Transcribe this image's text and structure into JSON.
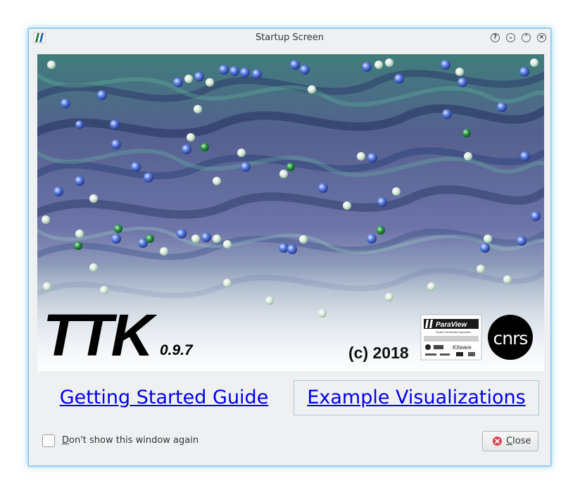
{
  "window": {
    "title": "Startup Screen",
    "buttons": {
      "help": "?",
      "minimize": "⌄",
      "maximize": "⌃",
      "close": "×"
    }
  },
  "banner": {
    "logo_text": "TTK",
    "version": "0.9.7",
    "copyright": "(c) 2018",
    "paraview_logo_text": "ParaView",
    "paraview_subtitle": "Parallel Visualization Application",
    "kitware_text": "Kitware",
    "cnrs_text": "cnrs"
  },
  "links": {
    "getting_started": "Getting Started Guide",
    "examples": "Example Visualizations"
  },
  "footer": {
    "checkbox_mnemonic": "D",
    "checkbox_rest": "on't show this window again",
    "checkbox_checked": false,
    "close_mnemonic": "C",
    "close_rest": "lose"
  },
  "colors": {
    "accent": "#3daee9",
    "link": "#0000ee",
    "window_bg": "#eff0f1",
    "close_icon": "#da4453"
  }
}
